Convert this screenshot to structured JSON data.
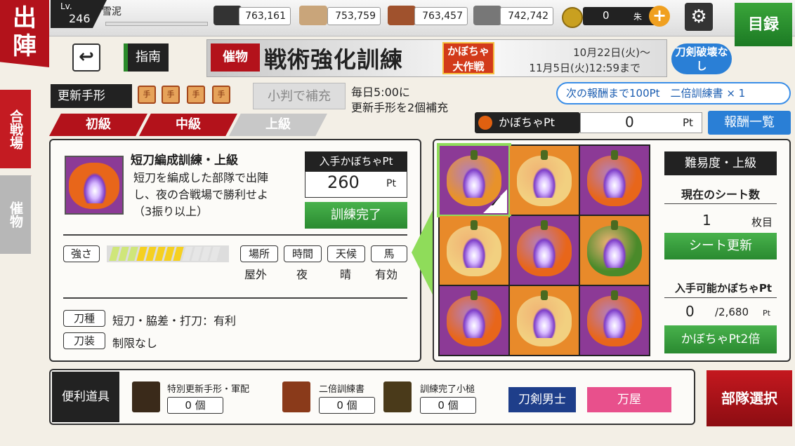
{
  "header": {
    "sortie": "出陣",
    "lv_label": "Lv.",
    "level": "246",
    "username": "雪泥",
    "resources": [
      "763,161",
      "753,759",
      "763,457",
      "742,742"
    ],
    "coins": "0",
    "coin_unit": "朱",
    "catalog": "目録",
    "colors": {
      "accent_red": "#b3121b",
      "green": "#2a8a30",
      "blue": "#2a7fd6"
    }
  },
  "sidebar": {
    "kassenba": "合戦場",
    "saimotsu": "催物"
  },
  "nav": {
    "back_icon": "back-arrow-icon",
    "guide": "指南"
  },
  "banner": {
    "tag": "催物",
    "title": "戦術強化訓練",
    "subtitle": "かぼちゃ大作戦",
    "date_start": "10月22日(火)〜",
    "date_end": "11月5日(火)12:59まで",
    "destroy_status": "刀剣破壊なし"
  },
  "renewal": {
    "label": "更新手形",
    "ticket_count": 4,
    "koban_button": "小判で補充",
    "note_line1": "毎日5:00に",
    "note_line2": "更新手形を2個補充"
  },
  "next_reward": "次の報酬まで100Pt　二倍訓練書 × 1",
  "level_tabs": [
    "初級",
    "中級",
    "上級"
  ],
  "pumpkin_pt": {
    "label": "かぼちゃPt",
    "value": "0",
    "unit": "Pt",
    "reward_list": "報酬一覧"
  },
  "mission": {
    "title": "短刀編成訓練・上級",
    "desc1": "短刀を編成した部隊で出陣",
    "desc2": "し、夜の合戦場で勝利せよ",
    "desc3": "（3振り以上）",
    "gain_label": "入手かぼちゃPt",
    "gain_value": "260",
    "gain_unit": "Pt",
    "complete_button": "訓練完了",
    "strength_label": "強さ",
    "strength_level": 0.7,
    "conditions": [
      {
        "label": "場所",
        "value": "屋外"
      },
      {
        "label": "時間",
        "value": "夜"
      },
      {
        "label": "天候",
        "value": "晴"
      },
      {
        "label": "馬",
        "value": "有効"
      }
    ],
    "sword_type_label": "刀種",
    "sword_type_value": "短刀・脇差・打刀：有利",
    "equip_label": "刀装",
    "equip_value": "制限なし"
  },
  "sheet": {
    "difficulty": "難易度・上級",
    "count_label": "現在のシート数",
    "count": "1",
    "count_unit": "枚目",
    "update_button": "シート更新",
    "available_label": "入手可能かぼちゃPt",
    "available_value": "0",
    "available_total": "/2,680",
    "available_unit": "Pt",
    "double_button": "かぼちゃPt2倍",
    "cells": [
      {
        "bg": "#8c3a96",
        "pumpkin": "#e8922a",
        "selected": true,
        "checked": true
      },
      {
        "bg": "#e88a2a",
        "pumpkin": "#f2d080",
        "selected": false,
        "checked": false
      },
      {
        "bg": "#8c3a96",
        "pumpkin": "#e8661a",
        "selected": false,
        "checked": false
      },
      {
        "bg": "#e88a2a",
        "pumpkin": "#f2d080",
        "selected": false,
        "checked": false
      },
      {
        "bg": "#8c3a96",
        "pumpkin": "#e8661a",
        "selected": false,
        "checked": false
      },
      {
        "bg": "#e88a2a",
        "pumpkin": "#4a8a2a",
        "selected": false,
        "checked": false
      },
      {
        "bg": "#8c3a96",
        "pumpkin": "#e8661a",
        "selected": false,
        "checked": false
      },
      {
        "bg": "#e88a2a",
        "pumpkin": "#f2d080",
        "selected": false,
        "checked": false
      },
      {
        "bg": "#8c3a96",
        "pumpkin": "#e8661a",
        "selected": false,
        "checked": false
      }
    ]
  },
  "tools": {
    "label": "便利道具",
    "items": [
      {
        "name": "特別更新手形・軍配",
        "count": "0",
        "unit": "個"
      },
      {
        "name": "二倍訓練書",
        "count": "0",
        "unit": "個"
      },
      {
        "name": "訓練完了小槌",
        "count": "0",
        "unit": "個"
      }
    ],
    "touken_logo": "刀剣男士",
    "yorozuya": "万屋",
    "butai_button": "部隊選択"
  }
}
